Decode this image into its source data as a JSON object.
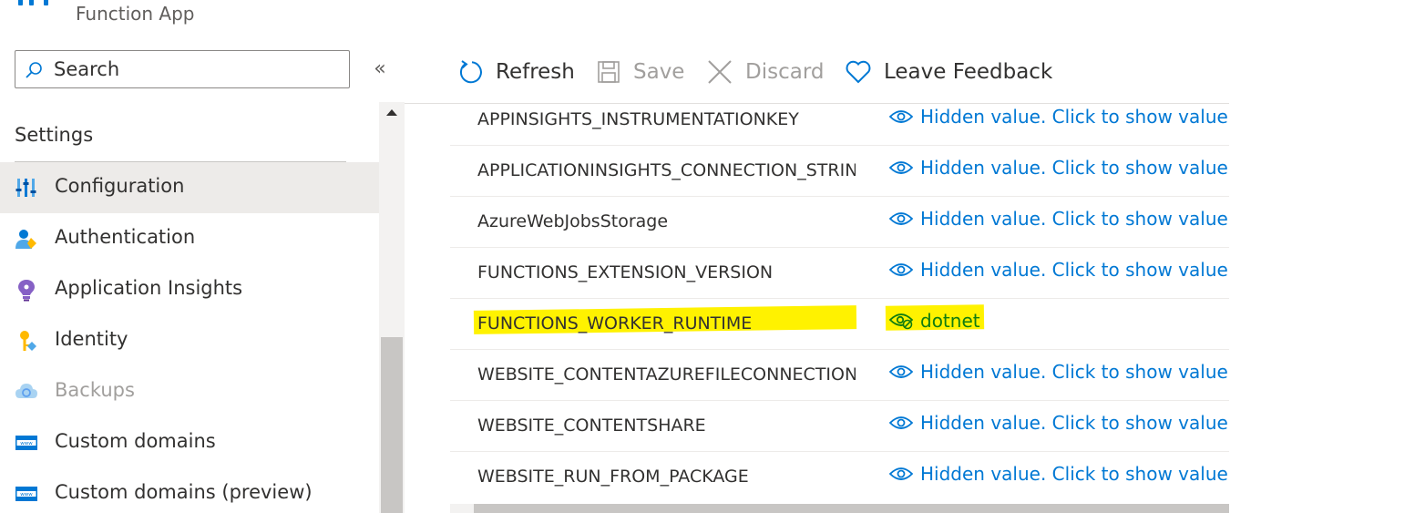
{
  "header": {
    "subtitle": "Function App"
  },
  "search": {
    "placeholder": "Search",
    "value": ""
  },
  "sidebar": {
    "collapse_glyph": "«",
    "section_title": "Settings",
    "items": [
      {
        "label": "Configuration",
        "icon": "configuration-icon",
        "active": true
      },
      {
        "label": "Authentication",
        "icon": "authentication-icon"
      },
      {
        "label": "Application Insights",
        "icon": "application-insights-icon"
      },
      {
        "label": "Identity",
        "icon": "identity-icon"
      },
      {
        "label": "Backups",
        "icon": "backups-icon",
        "disabled": true
      },
      {
        "label": "Custom domains",
        "icon": "custom-domains-icon"
      },
      {
        "label": "Custom domains (preview)",
        "icon": "custom-domains-preview-icon"
      }
    ]
  },
  "toolbar": {
    "refresh_label": "Refresh",
    "save_label": "Save",
    "discard_label": "Discard",
    "feedback_label": "Leave Feedback"
  },
  "app_settings": [
    {
      "name": "APPINSIGHTS_INSTRUMENTATIONKEY",
      "value": "Hidden value. Click to show value"
    },
    {
      "name": "APPLICATIONINSIGHTS_CONNECTION_STRIN",
      "value": "Hidden value. Click to show value"
    },
    {
      "name": "AzureWebJobsStorage",
      "value": "Hidden value. Click to show value"
    },
    {
      "name": "FUNCTIONS_EXTENSION_VERSION",
      "value": "Hidden value. Click to show value"
    },
    {
      "name": "FUNCTIONS_WORKER_RUNTIME",
      "value": "dotnet",
      "shown": true
    },
    {
      "name": "WEBSITE_CONTENTAZUREFILECONNECTIONS",
      "value": "Hidden value. Click to show value"
    },
    {
      "name": "WEBSITE_CONTENTSHARE",
      "value": "Hidden value. Click to show value"
    },
    {
      "name": "WEBSITE_RUN_FROM_PACKAGE",
      "value": "Hidden value. Click to show value"
    }
  ],
  "colors": {
    "accent": "#0078d4",
    "highlight": "#fff200",
    "shown_value": "#107c10"
  }
}
